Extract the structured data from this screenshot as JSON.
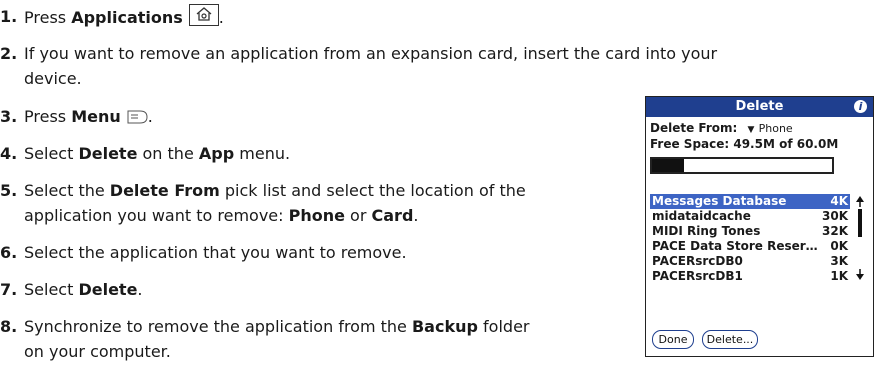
{
  "steps": [
    {
      "num": "1.",
      "parts": [
        "Press ",
        "Applications"
      ]
    },
    {
      "num": "2.",
      "line1": "If you want to remove an application from an expansion card, insert the card into your",
      "line2": "device."
    },
    {
      "num": "3.",
      "parts": [
        "Press ",
        "Menu"
      ]
    },
    {
      "num": "4.",
      "parts": [
        "Select ",
        "Delete",
        " on the ",
        "App",
        " menu."
      ]
    },
    {
      "num": "5.",
      "line1_parts": [
        "Select the ",
        "Delete From",
        " pick list and select the location of the"
      ],
      "line2_parts": [
        "application you want to remove: ",
        "Phone",
        " or ",
        "Card",
        "."
      ]
    },
    {
      "num": "6.",
      "parts": [
        "Select the application that you want to remove."
      ]
    },
    {
      "num": "7.",
      "parts": [
        "Select ",
        "Delete",
        "."
      ]
    },
    {
      "num": "8.",
      "line1_parts": [
        "Synchronize to remove the application from the ",
        "Backup",
        " folder"
      ],
      "line2": "on your computer."
    }
  ],
  "icons": {
    "applications": "home-icon",
    "menu": "menu-icon",
    "info": "info-icon"
  },
  "device": {
    "title": "Delete",
    "info_glyph": "i",
    "delete_from_label": "Delete From:",
    "delete_from_value": "Phone",
    "free_space": "Free Space: 49.5M of 60.0M",
    "free_space_used_fraction": 0.175,
    "apps": [
      {
        "name": "Messages Database",
        "size": "4K",
        "selected": true
      },
      {
        "name": "midataidcache",
        "size": "30K",
        "selected": false
      },
      {
        "name": "MIDI Ring Tones",
        "size": "32K",
        "selected": false
      },
      {
        "name": "PACE Data Store Reser…",
        "size": "0K",
        "selected": false
      },
      {
        "name": "PACERsrcDB0",
        "size": "3K",
        "selected": false
      },
      {
        "name": "PACERsrcDB1",
        "size": "1K",
        "selected": false
      }
    ],
    "buttons": {
      "done": "Done",
      "delete": "Delete..."
    },
    "accent": "#1f3f8f",
    "selection": "#3d64c4"
  }
}
